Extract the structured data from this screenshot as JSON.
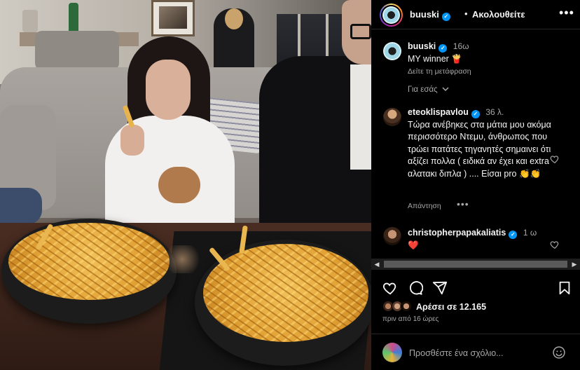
{
  "header": {
    "username": "buuski",
    "separator": "•",
    "follow_state": "Ακολουθείτε",
    "more": "•••"
  },
  "caption": {
    "username": "buuski",
    "time": "16ω",
    "text": "MY winner 🍟",
    "translate": "Δείτε τη μετάφραση"
  },
  "for_you": "Για εσάς",
  "comments": [
    {
      "username": "eteoklispavlou",
      "time": "36 λ.",
      "text": "Τώρα ανέβηκες στα μάτια μου ακόμα περισσότερο Ντεμυ, άνθρωπος που τρώει πατάτες τηγανητές σημαινει ότι αξίζει πολλα ( ειδικά αν έχει και extra αλατακι διπλα ) .... Είσαι pro 👏👏",
      "reply": "Απάντηση"
    },
    {
      "username": "christopherpapakaliatis",
      "time": "1 ω",
      "text": "❤️"
    }
  ],
  "likes": {
    "text": "Αρέσει σε 12.165"
  },
  "date": "πριν από 16 ώρες",
  "add_comment": {
    "placeholder": "Προσθέστε ένα σχόλιο..."
  },
  "icons": {
    "like": "heart-icon",
    "comment": "comment-icon",
    "share": "share-icon",
    "save": "bookmark-icon",
    "emoji": "emoji-icon",
    "more": "more-icon"
  },
  "colors": {
    "background": "#000000",
    "verified": "#0095f6",
    "heart": "#ed4956",
    "secondary_text": "#a8a8a8"
  }
}
